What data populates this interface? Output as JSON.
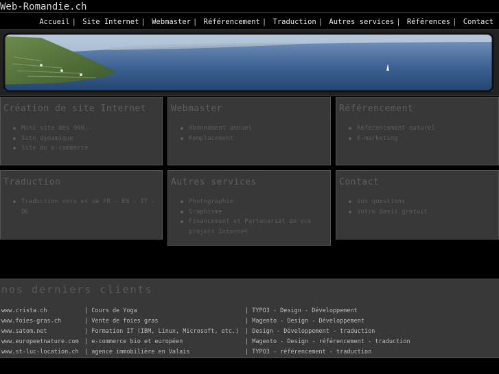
{
  "site": {
    "title": "Web-Romandie.ch"
  },
  "nav": {
    "items": [
      {
        "label": "Accueil"
      },
      {
        "label": "Site Internet"
      },
      {
        "label": "Webmaster"
      },
      {
        "label": "Référencement"
      },
      {
        "label": "Traduction"
      },
      {
        "label": "Autres services"
      },
      {
        "label": "Références"
      },
      {
        "label": "Contact"
      }
    ],
    "separator": "|"
  },
  "services": [
    {
      "title": "Création de site Internet",
      "items": [
        "Mini site dès 990.-",
        "Site dynamique",
        "Site de e-commerce"
      ]
    },
    {
      "title": "Webmaster",
      "items": [
        "Abonnement annuel",
        "Remplacement"
      ]
    },
    {
      "title": "Référencement",
      "items": [
        "Référencement naturel",
        "E-marketing"
      ]
    },
    {
      "title": "Traduction",
      "items": [
        "Traduction vers et de FR - EN - IT - DE"
      ]
    },
    {
      "title": "Autres services",
      "items": [
        "Photographie",
        "Graphisme",
        "Financement et Partenariat de vos projets Internet"
      ]
    },
    {
      "title": "Contact",
      "items": [
        "Vos questions",
        "Votre devis gratuit"
      ]
    }
  ],
  "clients": {
    "title": "nos derniers clients",
    "rows": [
      {
        "site": "www.crista.ch",
        "activity": "| Cours de Yoga",
        "work": "| TYPO3 - Design - Développement"
      },
      {
        "site": "www.foies-gras.ch",
        "activity": "| Vente de foies gras",
        "work": "| Magento - Design - Développement"
      },
      {
        "site": "www.satom.net",
        "activity": "| Formation IT (IBM, Linux, Microsoft, etc.)",
        "work": "| Design - Développement - traduction"
      },
      {
        "site": "www.europeetnature.com",
        "activity": "| e-commerce  bio et européen",
        "work": "| Magento - Design - référencement - traduction"
      },
      {
        "site": "www.st-luc-location.ch",
        "activity": "| agence immobilière en Valais",
        "work": "| TYPO3 - référencement - traduction"
      }
    ]
  }
}
